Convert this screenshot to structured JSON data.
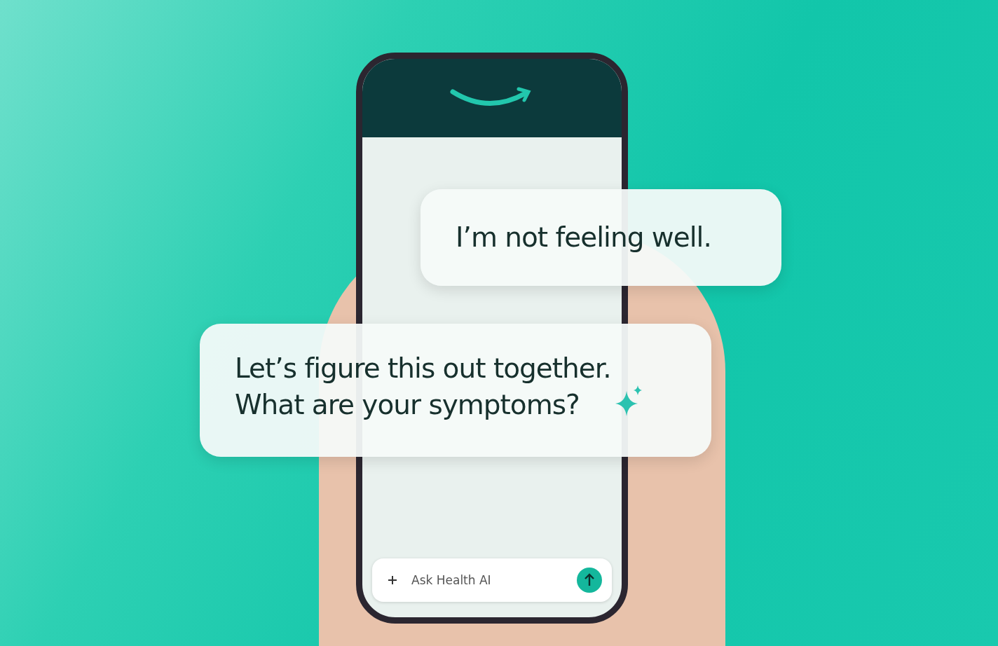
{
  "messages": [
    {
      "kind": "user",
      "text": "I’m not feeling well."
    },
    {
      "kind": "assistant",
      "text": "Let’s figure this out together.\nWhat are your symptoms?"
    }
  ],
  "composer": {
    "placeholder": "Ask Health AI"
  }
}
